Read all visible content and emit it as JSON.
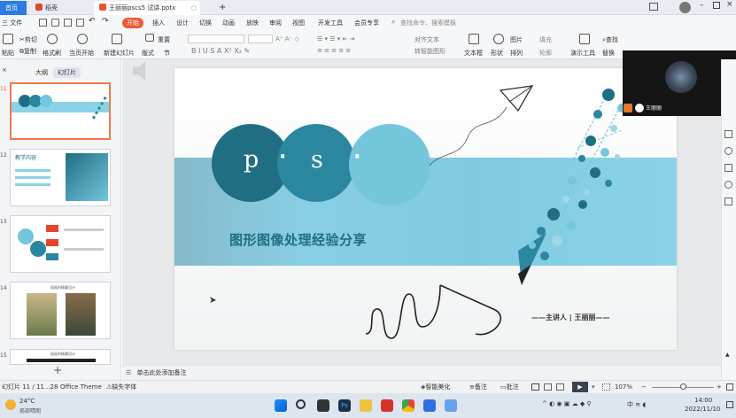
{
  "titlebar": {
    "tabs": [
      {
        "label": "首页"
      },
      {
        "label": "稻壳"
      },
      {
        "label": "王丽丽pscs5 试讲.pptx"
      }
    ],
    "new_tab": "+"
  },
  "menubar": {
    "file": "三 文件",
    "items": [
      "开始",
      "插入",
      "设计",
      "切换",
      "动画",
      "放映",
      "审阅",
      "视图",
      "开发工具",
      "会员专享"
    ],
    "search_placeholder": "查找命令、搜索模板"
  },
  "ribbon": {
    "cut": "剪切",
    "copy": "复制",
    "format_painter": "格式刷",
    "paste": "粘贴",
    "from_current": "当页开始",
    "new_slide": "新建幻灯片",
    "layout": "版式",
    "section": "节",
    "reset": "重置",
    "convert_smartart": "转智能图形",
    "text_box": "文本框",
    "shape": "形状",
    "arrange": "排列",
    "outline": "轮廓",
    "picture": "图片",
    "fill": "填充",
    "align_text": "对齐文本",
    "presentation_tool": "演示工具",
    "find": "查找",
    "replace": "替换"
  },
  "leftpanel": {
    "tabs": [
      "大纲",
      "幻灯片"
    ],
    "slides": [
      {
        "num": "11",
        "title": ""
      },
      {
        "num": "12",
        "title": "教学内容"
      },
      {
        "num": "13",
        "title": ""
      },
      {
        "num": "14",
        "title": "插画的精美设计"
      },
      {
        "num": "15",
        "title": "插画的精美设计"
      }
    ],
    "add_slide": "+"
  },
  "slide": {
    "letter_p": "p",
    "letter_s": "s",
    "bullet": "·",
    "title": "图形图像处理经验分享",
    "presenter": "——主讲人 | 王丽丽——"
  },
  "notes": {
    "placeholder": "单击此处添加备注"
  },
  "statusbar": {
    "slide_pos": "幻灯片 11 / 11...28",
    "theme": "Office Theme",
    "missing_font": "缺失字体",
    "smart_beautify": "智能美化",
    "notes": "备注",
    "comments": "批注",
    "zoom": "107%"
  },
  "video": {
    "name": "王丽丽"
  },
  "taskbar": {
    "temp": "24°C",
    "weather": "局部晴朗",
    "time": "14:00",
    "date": "2022/11/10"
  },
  "colors": {
    "accent": "#ee5a35",
    "teal_dark": "#1f6e83",
    "teal_mid": "#2b86a0",
    "teal_light": "#74c6dd",
    "band": "#8bd2e8"
  }
}
